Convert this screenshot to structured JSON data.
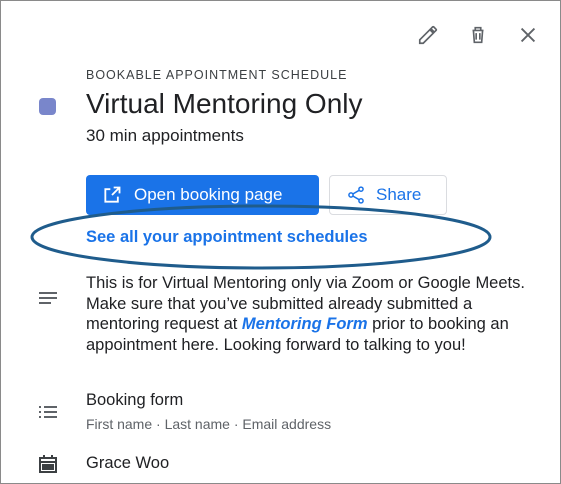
{
  "toolbar": {
    "edit_icon": "pencil-icon",
    "delete_icon": "trash-icon",
    "close_icon": "close-icon"
  },
  "schedule": {
    "kicker": "BOOKABLE APPOINTMENT SCHEDULE",
    "title": "Virtual Mentoring Only",
    "subtitle": "30 min appointments",
    "color": "#7986cb"
  },
  "actions": {
    "open_label": "Open booking page",
    "share_label": "Share",
    "see_all_label": "See all your appointment schedules"
  },
  "description": {
    "line1": "This is for Virtual Mentoring only via Zoom or Google Meets.",
    "line2_pre": "Make sure that you’ve submitted already submitted a mentoring request at ",
    "link": "Mentoring Form",
    "line2_post": " prior to booking an appointment here. Looking forward to talking to you!"
  },
  "booking_form": {
    "title": "Booking form",
    "fields": "First name · Last name · Email address"
  },
  "organizer": {
    "name": "Grace Woo"
  },
  "colors": {
    "accent": "#1a73e8",
    "highlight_ellipse": "#1f5c8c"
  }
}
